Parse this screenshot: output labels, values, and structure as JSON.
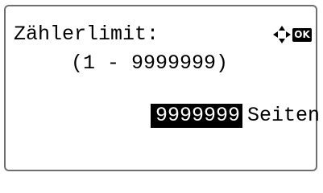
{
  "panel": {
    "title": "Zählerlimit:",
    "range": "(1 - 9999999)",
    "value": "9999999",
    "unit": "Seiten",
    "ok_label": "OK",
    "nav_icon": "four-way-arrow-icon"
  },
  "colors": {
    "text": "#000000",
    "background": "#ffffff",
    "highlight_bg": "#000000",
    "highlight_fg": "#ffffff",
    "frame": "#6f6f6f"
  }
}
